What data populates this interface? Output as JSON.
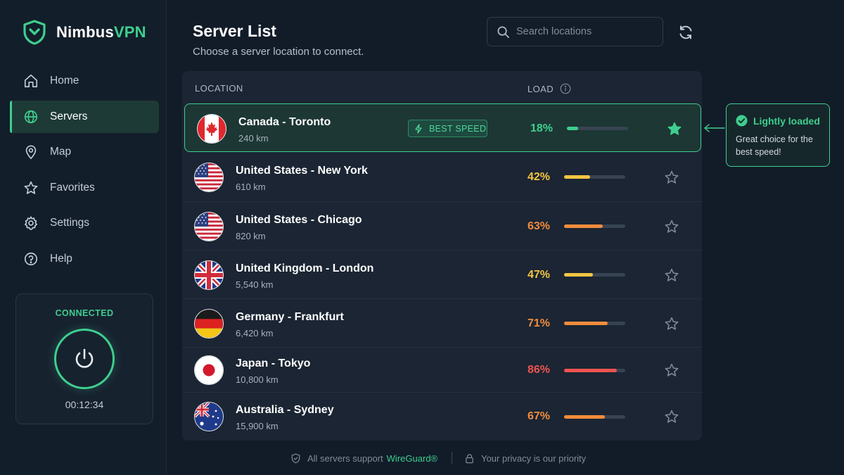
{
  "app": {
    "name_part1": "Nimbus",
    "name_part2": "VPN"
  },
  "sidebar": {
    "items": [
      {
        "label": "Home",
        "icon": "home-icon",
        "active": false
      },
      {
        "label": "Servers",
        "icon": "globe-icon",
        "active": true
      },
      {
        "label": "Map",
        "icon": "map-pin-icon",
        "active": false
      },
      {
        "label": "Favorites",
        "icon": "star-icon",
        "active": false
      },
      {
        "label": "Settings",
        "icon": "gear-icon",
        "active": false
      },
      {
        "label": "Help",
        "icon": "help-icon",
        "active": false
      }
    ],
    "connection": {
      "status": "CONNECTED",
      "timer": "00:12:34"
    }
  },
  "header": {
    "title": "Server List",
    "subtitle": "Choose a server location to connect.",
    "search_placeholder": "Search locations"
  },
  "table": {
    "col_location": "LOCATION",
    "col_load": "LOAD",
    "best_badge": "BEST SPEED",
    "rows": [
      {
        "name": "Canada - Toronto",
        "distance": "240 km",
        "load": "18%",
        "load_fraction": 0.18,
        "color": "#3ecf8e",
        "favorite": true,
        "best": true,
        "flag": "ca"
      },
      {
        "name": "United States - New York",
        "distance": "610 km",
        "load": "42%",
        "load_fraction": 0.42,
        "color": "#f5c542",
        "favorite": false,
        "best": false,
        "flag": "us"
      },
      {
        "name": "United States - Chicago",
        "distance": "820 km",
        "load": "63%",
        "load_fraction": 0.63,
        "color": "#f28c3c",
        "favorite": false,
        "best": false,
        "flag": "us"
      },
      {
        "name": "United Kingdom - London",
        "distance": "5,540 km",
        "load": "47%",
        "load_fraction": 0.47,
        "color": "#f5c542",
        "favorite": false,
        "best": false,
        "flag": "uk"
      },
      {
        "name": "Germany - Frankfurt",
        "distance": "6,420 km",
        "load": "71%",
        "load_fraction": 0.71,
        "color": "#f28c3c",
        "favorite": false,
        "best": false,
        "flag": "de"
      },
      {
        "name": "Japan - Tokyo",
        "distance": "10,800 km",
        "load": "86%",
        "load_fraction": 0.86,
        "color": "#ef5350",
        "favorite": false,
        "best": false,
        "flag": "jp"
      },
      {
        "name": "Australia - Sydney",
        "distance": "15,900 km",
        "load": "67%",
        "load_fraction": 0.67,
        "color": "#f28c3c",
        "favorite": false,
        "best": false,
        "flag": "au"
      }
    ]
  },
  "tooltip": {
    "title": "Lightly loaded",
    "body": "Great choice for the best speed!"
  },
  "footer": {
    "support_text": "All servers support",
    "protocol": "WireGuard®",
    "privacy_text": "Your privacy is our priority"
  },
  "colors": {
    "accent": "#3ecf8e",
    "background": "#121c29",
    "panel": "#1b2533"
  }
}
